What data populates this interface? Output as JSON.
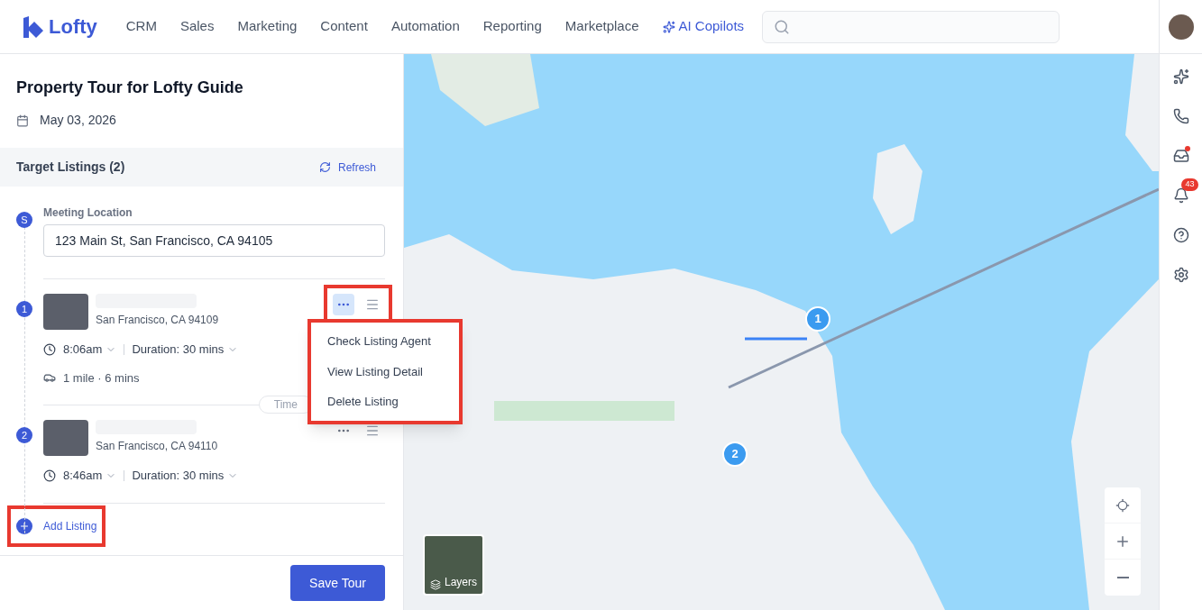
{
  "nav": {
    "logo": "Lofty",
    "items": [
      {
        "label": "CRM"
      },
      {
        "label": "Sales"
      },
      {
        "label": "Marketing"
      },
      {
        "label": "Content"
      },
      {
        "label": "Automation"
      },
      {
        "label": "Reporting"
      },
      {
        "label": "Marketplace"
      }
    ],
    "ai": "AI Copilots"
  },
  "rail": {
    "notification_count": "43",
    "inbox_unread": true
  },
  "tour": {
    "title": "Property Tour for Lofty Guide",
    "date": "May 03, 2026"
  },
  "listings_header": {
    "title": "Target Listings (2)",
    "refresh": "Refresh"
  },
  "meeting": {
    "badge": "S",
    "label": "Meeting Location",
    "value": "123 Main St, San Francisco, CA 94105"
  },
  "stops": [
    {
      "badge": "1",
      "city": "San Francisco, CA 94109",
      "time": "8:06am",
      "duration": "Duration: 30 mins",
      "travel": "1 mile · 6 mins",
      "menu_open": true,
      "highlighted": true
    },
    {
      "badge": "2",
      "city": "San Francisco, CA 94110",
      "time": "8:46am",
      "duration": "Duration: 30 mins",
      "menu_open": false,
      "highlighted": false
    }
  ],
  "gap_pill": "Time",
  "context_menu": {
    "highlighted": true,
    "items": [
      {
        "label": "Check Listing Agent"
      },
      {
        "label": "View Listing Detail"
      },
      {
        "label": "Delete Listing"
      }
    ]
  },
  "add_listing": {
    "label": "Add Listing",
    "highlighted": true
  },
  "save": "Save Tour",
  "map": {
    "pins": [
      {
        "label": "1"
      },
      {
        "label": "2"
      }
    ],
    "layers": "Layers"
  }
}
